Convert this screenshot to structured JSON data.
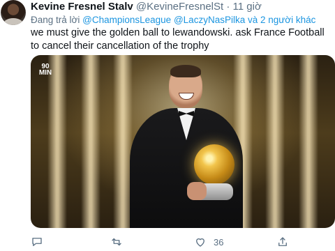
{
  "tweet": {
    "author_name": "Kevine Fresnel Stalv",
    "handle": "@KevineFresnelSt",
    "separator": "·",
    "time": "11 giờ",
    "reply_prefix": "Đang trả lời",
    "reply_to": [
      "@ChampionsLeague",
      "@LaczyNasPilka"
    ],
    "reply_others": "và 2 người khác",
    "text": "we must give the golden ball to lewandowski. ask France Football to cancel their cancellation of the trophy",
    "media": {
      "logo_text": "90 MIN"
    }
  },
  "actions": {
    "reply_icon": "reply-icon",
    "retweet_icon": "retweet-icon",
    "like_icon": "heart-icon",
    "like_count": "36",
    "share_icon": "share-icon"
  }
}
